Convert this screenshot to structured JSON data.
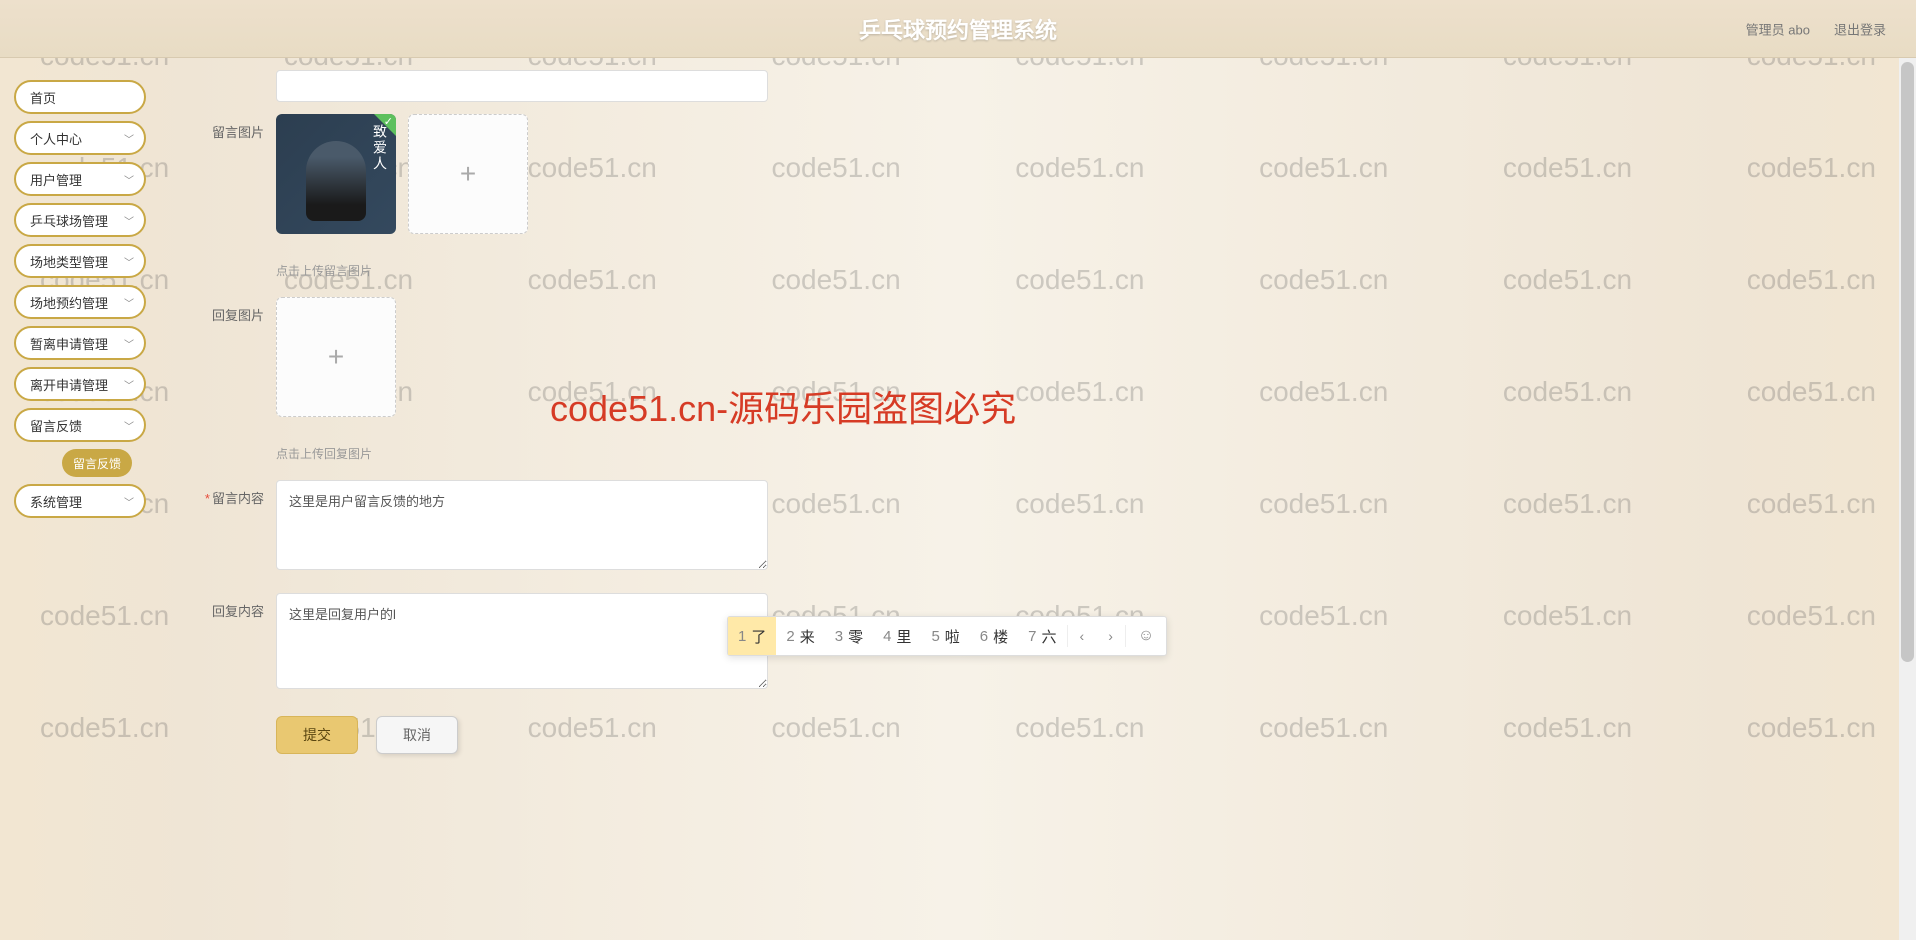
{
  "header": {
    "title": "乒乓球预约管理系统",
    "admin_label": "管理员 abo",
    "logout_label": "退出登录"
  },
  "sidebar": {
    "items": [
      {
        "label": "首页",
        "expandable": false
      },
      {
        "label": "个人中心",
        "expandable": true
      },
      {
        "label": "用户管理",
        "expandable": true
      },
      {
        "label": "乒乓球场管理",
        "expandable": true
      },
      {
        "label": "场地类型管理",
        "expandable": true
      },
      {
        "label": "场地预约管理",
        "expandable": true
      },
      {
        "label": "暂离申请管理",
        "expandable": true
      },
      {
        "label": "离开申请管理",
        "expandable": true
      },
      {
        "label": "留言反馈",
        "expandable": true
      },
      {
        "label": "系统管理",
        "expandable": true
      }
    ],
    "active_sub": "留言反馈"
  },
  "form": {
    "msg_image_label": "留言图片",
    "msg_image_hint": "点击上传留言图片",
    "reply_image_label": "回复图片",
    "reply_image_hint": "点击上传回复图片",
    "msg_content_label": "留言内容",
    "msg_content_value": "这里是用户留言反馈的地方",
    "reply_content_label": "回复内容",
    "reply_content_value": "这里是回复用户的l",
    "uploaded_thumb_caption": "致爱人",
    "submit_label": "提交",
    "cancel_label": "取消"
  },
  "ime": {
    "candidates": [
      {
        "num": "1",
        "char": "了"
      },
      {
        "num": "2",
        "char": "来"
      },
      {
        "num": "3",
        "char": "零"
      },
      {
        "num": "4",
        "char": "里"
      },
      {
        "num": "5",
        "char": "啦"
      },
      {
        "num": "6",
        "char": "楼"
      },
      {
        "num": "7",
        "char": "六"
      }
    ],
    "prev": "‹",
    "next": "›",
    "emoji": "☺"
  },
  "watermark": {
    "text": "code51.cn",
    "center": "code51.cn-源码乐园盗图必究"
  }
}
